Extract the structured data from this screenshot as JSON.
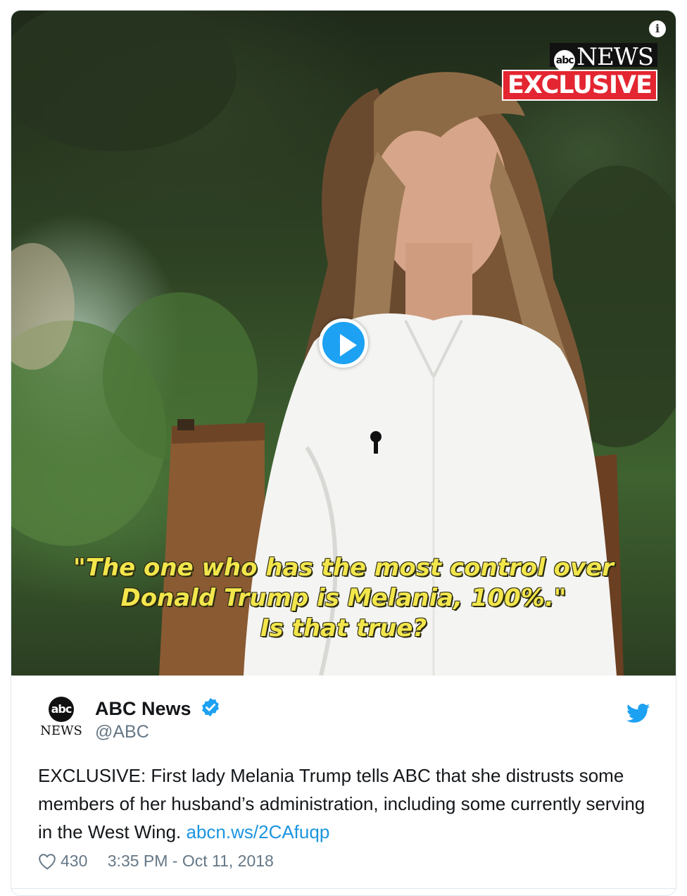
{
  "media": {
    "info_icon": "info-icon",
    "network_badge": "NEWS",
    "network_logo": "abc",
    "exclusive_badge": "EXCLUSIVE",
    "play_icon": "play-icon",
    "caption_lines": [
      "\"The one who has the most control over",
      "Donald Trump is Melania, 100%.\"",
      "Is that true?"
    ]
  },
  "author": {
    "avatar_logo": "abc",
    "avatar_text": "NEWS",
    "name": "ABC News",
    "handle": "@ABC",
    "verified_icon": "verified-badge-icon"
  },
  "tweet": {
    "text": "EXCLUSIVE: First lady Melania Trump tells ABC that she distrusts some members of her husband’s administration, including some currently serving in the West Wing.",
    "link": "abcn.ws/2CAfuqp",
    "likes": "430",
    "timestamp": "3:35 PM - Oct 11, 2018"
  },
  "colors": {
    "twitter_blue": "#1da1f2",
    "link": "#1b95e0",
    "caption_yellow": "#f2e64c",
    "exclusive_red": "#e32631"
  }
}
